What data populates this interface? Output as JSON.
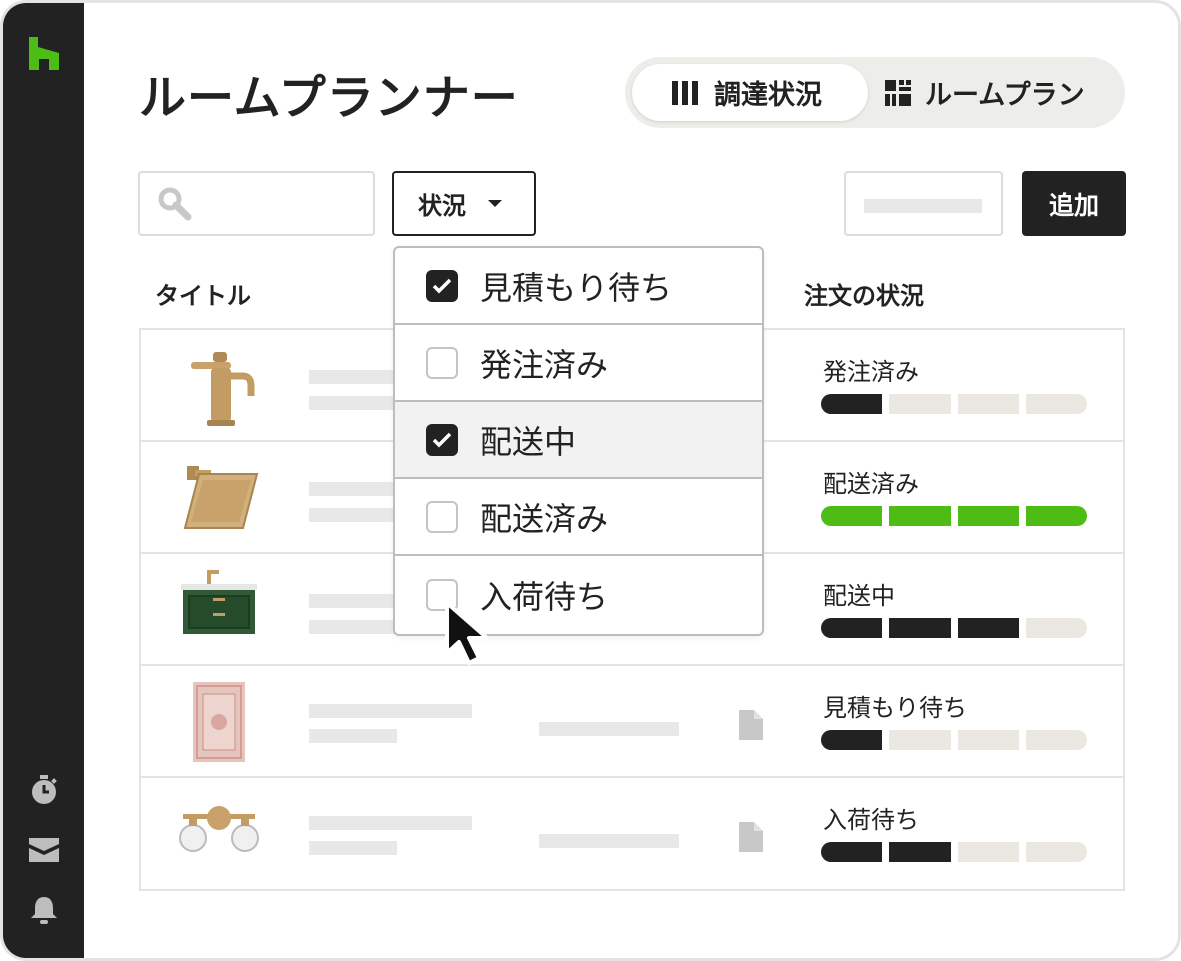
{
  "app": {
    "title": "ルームプランナー"
  },
  "sidebar": {
    "icons": [
      "houzz-logo-icon",
      "timer-icon",
      "inbox-icon",
      "bell-icon"
    ],
    "bg_color": "#222222",
    "logo_color": "#4dbc15"
  },
  "view_toggle": {
    "options": [
      {
        "label": "調達状況",
        "icon": "columns-icon",
        "active": true
      },
      {
        "label": "ルームプラン",
        "icon": "grid-icon",
        "active": false
      }
    ]
  },
  "toolbar": {
    "search_icon": "search-icon",
    "filter_label": "状況",
    "add_label": "追加"
  },
  "table": {
    "columns": [
      "タイトル",
      "注文の状況"
    ],
    "rows": [
      {
        "product": "faucet",
        "status": "発注済み",
        "progress_steps_total": 4,
        "progress_steps_done": 1,
        "progress_color": "dark"
      },
      {
        "product": "shower-head",
        "status": "配送済み",
        "progress_steps_total": 4,
        "progress_steps_done": 4,
        "progress_color": "green"
      },
      {
        "product": "vanity",
        "status": "配送中",
        "progress_steps_total": 4,
        "progress_steps_done": 3,
        "progress_color": "dark"
      },
      {
        "product": "rug",
        "status": "見積もり待ち",
        "progress_steps_total": 4,
        "progress_steps_done": 1,
        "progress_color": "dark"
      },
      {
        "product": "vanity-light",
        "status": "入荷待ち",
        "progress_steps_total": 4,
        "progress_steps_done": 2,
        "progress_color": "dark"
      }
    ]
  },
  "filter_dropdown": {
    "options": [
      {
        "label": "見積もり待ち",
        "checked": true
      },
      {
        "label": "発注済み",
        "checked": false
      },
      {
        "label": "配送中",
        "checked": true,
        "hovered": true
      },
      {
        "label": "配送済み",
        "checked": false
      },
      {
        "label": "入荷待ち",
        "checked": false
      }
    ]
  },
  "colors": {
    "accent_green": "#4dbc15",
    "dark": "#222222",
    "progress_empty": "#ebe8e2"
  }
}
